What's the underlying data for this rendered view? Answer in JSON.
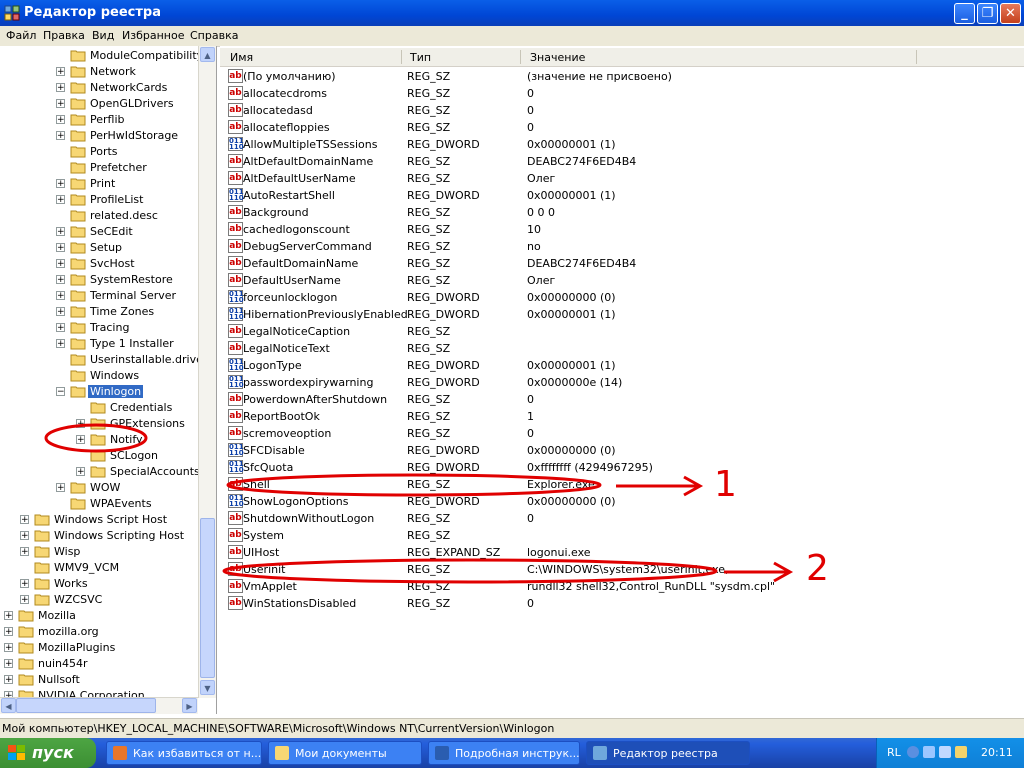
{
  "window": {
    "title": "Редактор реестра"
  },
  "menu": [
    "Файл",
    "Правка",
    "Вид",
    "Избранное",
    "Справка"
  ],
  "tree": [
    {
      "label": "ModuleCompatibility",
      "level": 3,
      "expander": ""
    },
    {
      "label": "Network",
      "level": 3,
      "expander": "+"
    },
    {
      "label": "NetworkCards",
      "level": 3,
      "expander": "+"
    },
    {
      "label": "OpenGLDrivers",
      "level": 3,
      "expander": "+"
    },
    {
      "label": "Perflib",
      "level": 3,
      "expander": "+"
    },
    {
      "label": "PerHwIdStorage",
      "level": 3,
      "expander": "+"
    },
    {
      "label": "Ports",
      "level": 3,
      "expander": ""
    },
    {
      "label": "Prefetcher",
      "level": 3,
      "expander": ""
    },
    {
      "label": "Print",
      "level": 3,
      "expander": "+"
    },
    {
      "label": "ProfileList",
      "level": 3,
      "expander": "+"
    },
    {
      "label": "related.desc",
      "level": 3,
      "expander": ""
    },
    {
      "label": "SeCEdit",
      "level": 3,
      "expander": "+"
    },
    {
      "label": "Setup",
      "level": 3,
      "expander": "+"
    },
    {
      "label": "SvcHost",
      "level": 3,
      "expander": "+"
    },
    {
      "label": "SystemRestore",
      "level": 3,
      "expander": "+"
    },
    {
      "label": "Terminal Server",
      "level": 3,
      "expander": "+"
    },
    {
      "label": "Time Zones",
      "level": 3,
      "expander": "+"
    },
    {
      "label": "Tracing",
      "level": 3,
      "expander": "+"
    },
    {
      "label": "Type 1 Installer",
      "level": 3,
      "expander": "+"
    },
    {
      "label": "Userinstallable.drivers",
      "level": 3,
      "expander": ""
    },
    {
      "label": "Windows",
      "level": 3,
      "expander": ""
    },
    {
      "label": "Winlogon",
      "level": 3,
      "expander": "-",
      "selected": true
    },
    {
      "label": "Credentials",
      "level": 4,
      "expander": ""
    },
    {
      "label": "GPExtensions",
      "level": 4,
      "expander": "+"
    },
    {
      "label": "Notify",
      "level": 4,
      "expander": "+"
    },
    {
      "label": "SCLogon",
      "level": 4,
      "expander": ""
    },
    {
      "label": "SpecialAccounts",
      "level": 4,
      "expander": "+"
    },
    {
      "label": "WOW",
      "level": 3,
      "expander": "+"
    },
    {
      "label": "WPAEvents",
      "level": 3,
      "expander": ""
    },
    {
      "label": "Windows Script Host",
      "level": 1,
      "expander": "+"
    },
    {
      "label": "Windows Scripting Host",
      "level": 1,
      "expander": "+"
    },
    {
      "label": "Wisp",
      "level": 1,
      "expander": "+"
    },
    {
      "label": "WMV9_VCM",
      "level": 1,
      "expander": ""
    },
    {
      "label": "Works",
      "level": 1,
      "expander": "+"
    },
    {
      "label": "WZCSVC",
      "level": 1,
      "expander": "+"
    },
    {
      "label": "Mozilla",
      "level": 0,
      "expander": "+"
    },
    {
      "label": "mozilla.org",
      "level": 0,
      "expander": "+"
    },
    {
      "label": "MozillaPlugins",
      "level": 0,
      "expander": "+"
    },
    {
      "label": "nuin454r",
      "level": 0,
      "expander": "+"
    },
    {
      "label": "Nullsoft",
      "level": 0,
      "expander": "+"
    },
    {
      "label": "NVIDIA Corporation",
      "level": 0,
      "expander": "+"
    }
  ],
  "list": {
    "columns": [
      "Имя",
      "Тип",
      "Значение"
    ],
    "rows": [
      {
        "name": "(По умолчанию)",
        "type": "REG_SZ",
        "value": "(значение не присвоено)",
        "icon": "string-value-icon"
      },
      {
        "name": "allocatecdroms",
        "type": "REG_SZ",
        "value": "0",
        "icon": "string-value-icon"
      },
      {
        "name": "allocatedasd",
        "type": "REG_SZ",
        "value": "0",
        "icon": "string-value-icon"
      },
      {
        "name": "allocatefloppies",
        "type": "REG_SZ",
        "value": "0",
        "icon": "string-value-icon"
      },
      {
        "name": "AllowMultipleTSSessions",
        "type": "REG_DWORD",
        "value": "0x00000001 (1)",
        "icon": "dword-value-icon"
      },
      {
        "name": "AltDefaultDomainName",
        "type": "REG_SZ",
        "value": "DEABC274F6ED4B4",
        "icon": "string-value-icon"
      },
      {
        "name": "AltDefaultUserName",
        "type": "REG_SZ",
        "value": "Олег",
        "icon": "string-value-icon"
      },
      {
        "name": "AutoRestartShell",
        "type": "REG_DWORD",
        "value": "0x00000001 (1)",
        "icon": "dword-value-icon"
      },
      {
        "name": "Background",
        "type": "REG_SZ",
        "value": "0 0 0",
        "icon": "string-value-icon"
      },
      {
        "name": "cachedlogonscount",
        "type": "REG_SZ",
        "value": "10",
        "icon": "string-value-icon"
      },
      {
        "name": "DebugServerCommand",
        "type": "REG_SZ",
        "value": "no",
        "icon": "string-value-icon"
      },
      {
        "name": "DefaultDomainName",
        "type": "REG_SZ",
        "value": "DEABC274F6ED4B4",
        "icon": "string-value-icon"
      },
      {
        "name": "DefaultUserName",
        "type": "REG_SZ",
        "value": "Олег",
        "icon": "string-value-icon"
      },
      {
        "name": "forceunlocklogon",
        "type": "REG_DWORD",
        "value": "0x00000000 (0)",
        "icon": "dword-value-icon"
      },
      {
        "name": "HibernationPreviouslyEnabled",
        "type": "REG_DWORD",
        "value": "0x00000001 (1)",
        "icon": "dword-value-icon"
      },
      {
        "name": "LegalNoticeCaption",
        "type": "REG_SZ",
        "value": "",
        "icon": "string-value-icon"
      },
      {
        "name": "LegalNoticeText",
        "type": "REG_SZ",
        "value": "",
        "icon": "string-value-icon"
      },
      {
        "name": "LogonType",
        "type": "REG_DWORD",
        "value": "0x00000001 (1)",
        "icon": "dword-value-icon"
      },
      {
        "name": "passwordexpirywarning",
        "type": "REG_DWORD",
        "value": "0x0000000e (14)",
        "icon": "dword-value-icon"
      },
      {
        "name": "PowerdownAfterShutdown",
        "type": "REG_SZ",
        "value": "0",
        "icon": "string-value-icon"
      },
      {
        "name": "ReportBootOk",
        "type": "REG_SZ",
        "value": "1",
        "icon": "string-value-icon"
      },
      {
        "name": "scremoveoption",
        "type": "REG_SZ",
        "value": "0",
        "icon": "string-value-icon"
      },
      {
        "name": "SFCDisable",
        "type": "REG_DWORD",
        "value": "0x00000000 (0)",
        "icon": "dword-value-icon"
      },
      {
        "name": "SfcQuota",
        "type": "REG_DWORD",
        "value": "0xffffffff (4294967295)",
        "icon": "dword-value-icon"
      },
      {
        "name": "Shell",
        "type": "REG_SZ",
        "value": "Explorer.exe",
        "icon": "string-value-icon"
      },
      {
        "name": "ShowLogonOptions",
        "type": "REG_DWORD",
        "value": "0x00000000 (0)",
        "icon": "dword-value-icon"
      },
      {
        "name": "ShutdownWithoutLogon",
        "type": "REG_SZ",
        "value": "0",
        "icon": "string-value-icon"
      },
      {
        "name": "System",
        "type": "REG_SZ",
        "value": "",
        "icon": "string-value-icon"
      },
      {
        "name": "UIHost",
        "type": "REG_EXPAND_SZ",
        "value": "logonui.exe",
        "icon": "string-value-icon"
      },
      {
        "name": "Userinit",
        "type": "REG_SZ",
        "value": "C:\\WINDOWS\\system32\\userinit.exe,",
        "icon": "string-value-icon"
      },
      {
        "name": "VmApplet",
        "type": "REG_SZ",
        "value": "rundll32 shell32,Control_RunDLL \"sysdm.cpl\"",
        "icon": "string-value-icon"
      },
      {
        "name": "WinStationsDisabled",
        "type": "REG_SZ",
        "value": "0",
        "icon": "string-value-icon"
      }
    ]
  },
  "annotations": {
    "label_1": "1",
    "label_2": "2",
    "color": "#e00000"
  },
  "status": {
    "path": "Мой компьютер\\HKEY_LOCAL_MACHINE\\SOFTWARE\\Microsoft\\Windows NT\\CurrentVersion\\Winlogon"
  },
  "taskbar": {
    "start_label": "пуск",
    "tasks": [
      {
        "label": "Как избавиться от н...",
        "icon": "firefox-icon",
        "active": false
      },
      {
        "label": "Мои документы",
        "icon": "folder-icon",
        "active": false
      },
      {
        "label": "Подробная инструк...",
        "icon": "word-icon",
        "active": false
      },
      {
        "label": "Редактор реестра",
        "icon": "regedit-icon",
        "active": true
      }
    ],
    "tray_lang": "RL",
    "clock": "20:11"
  }
}
